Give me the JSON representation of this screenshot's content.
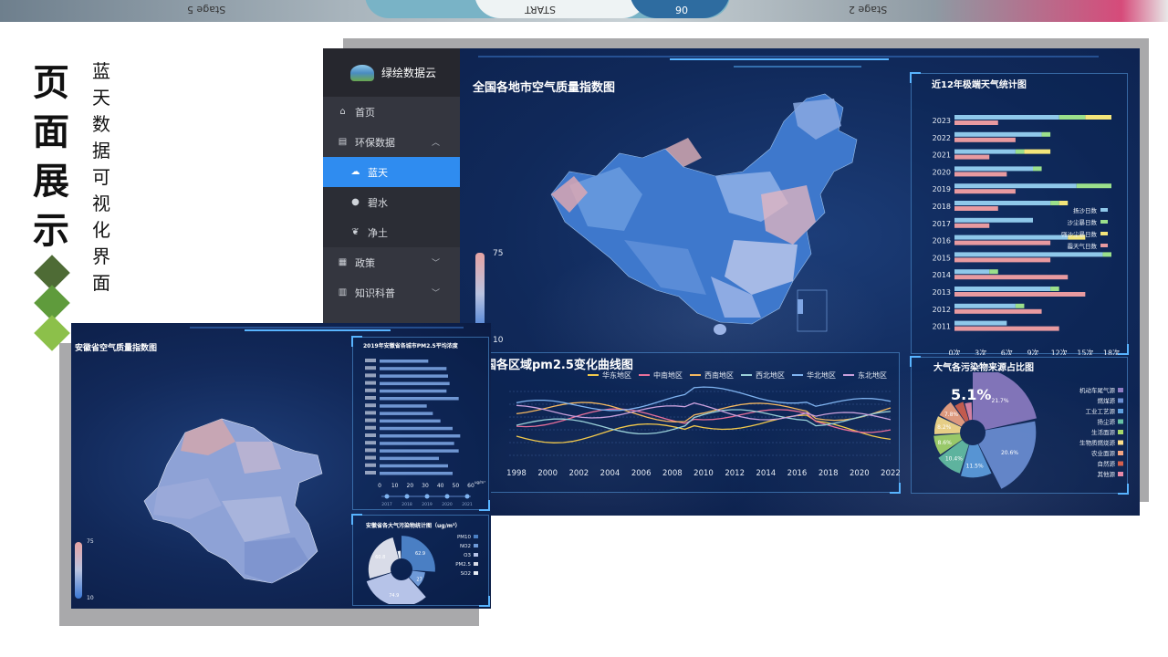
{
  "slide": {
    "title_chars": [
      "页",
      "面",
      "展",
      "示"
    ],
    "subtitle_chars": [
      "蓝",
      "天",
      "数",
      "据",
      "可",
      "视",
      "化",
      "界",
      "面"
    ],
    "diamond_colors": [
      "#4e6b35",
      "#5f9b3c",
      "#8cc04a"
    ]
  },
  "top_strip": {
    "text_left": "Stage 5",
    "text_mid": "START",
    "text_mid2": "06",
    "text_right": "Stage 2"
  },
  "main_dashboard": {
    "app_name": "绿绘数据云",
    "menu": [
      {
        "label": "首页",
        "icon": "home-icon"
      },
      {
        "label": "环保数据",
        "icon": "chart-icon",
        "expanded": true
      },
      {
        "label": "蓝天",
        "icon": "cloud-icon",
        "active": true
      },
      {
        "label": "碧水",
        "icon": "drop-icon"
      },
      {
        "label": "净土",
        "icon": "leaf-icon"
      },
      {
        "label": "政策",
        "icon": "book-icon"
      },
      {
        "label": "知识科普",
        "icon": "grid-icon"
      }
    ],
    "map_title": "全国各地市空气质量指数图",
    "map_legend_max": "75",
    "map_legend_min": "10",
    "weather_title": "近12年极端天气统计图",
    "weather_legend": [
      "扬沙日数",
      "沙尘暴日数",
      "强沙尘暴日数",
      "霾天气日数"
    ],
    "weather_legend_colors": [
      "#8fc8ea",
      "#9be08b",
      "#f3e57a",
      "#e89aa0"
    ],
    "weather_chart": {
      "type": "bar",
      "categories": [
        "2023",
        "2022",
        "2021",
        "2020",
        "2019",
        "2018",
        "2017",
        "2016",
        "2015",
        "2014",
        "2013",
        "2012",
        "2011"
      ],
      "series": [
        {
          "name": "扬沙日数",
          "values": [
            12,
            10,
            7,
            9,
            14,
            11,
            9,
            13,
            17,
            4,
            11,
            7,
            6
          ]
        },
        {
          "name": "沙尘暴日数",
          "values": [
            3,
            1,
            1,
            1,
            4,
            1,
            0,
            0,
            1,
            1,
            1,
            1,
            0
          ]
        },
        {
          "name": "强沙尘暴日数",
          "values": [
            3,
            0,
            3,
            0,
            0,
            1,
            0,
            2,
            0,
            0,
            0,
            0,
            0
          ]
        },
        {
          "name": "霾天气日数",
          "values": [
            5,
            7,
            4,
            6,
            7,
            5,
            4,
            11,
            11,
            13,
            15,
            10,
            12
          ]
        }
      ],
      "xticks": [
        "0次",
        "3次",
        "6次",
        "9次",
        "12次",
        "15次",
        "18次"
      ],
      "xlim": [
        0,
        18
      ]
    },
    "pm_title": "全国各区域pm2.5变化曲线图",
    "pm_chart": {
      "type": "line",
      "series_names": [
        "华东地区",
        "中南地区",
        "西南地区",
        "西北地区",
        "华北地区",
        "东北地区"
      ],
      "series_colors": [
        "#f2c94c",
        "#e86f9a",
        "#f4b860",
        "#9ad0d8",
        "#7fb3f0",
        "#c9a0dc"
      ],
      "x": [
        "1998",
        "2000",
        "2002",
        "2004",
        "2006",
        "2008",
        "2010",
        "2012",
        "2014",
        "2016",
        "2018",
        "2020",
        "2022"
      ],
      "y_unit": "μg/m³"
    },
    "pollution_title": "大气各污染物来源占比图",
    "pollution_center": "5.1%",
    "pollution_chart": {
      "type": "pie",
      "labels": [
        "机动车尾气源",
        "燃煤源",
        "工业工艺源",
        "扬尘源",
        "生活面源",
        "生物质燃烧源",
        "农业面源",
        "自然源",
        "其他源"
      ],
      "values": [
        21.7,
        20.6,
        11.5,
        10.4,
        8.6,
        8.2,
        7.8,
        5.1,
        4.1
      ],
      "colors": [
        "#8e7cc3",
        "#6b8fd4",
        "#5ea0e0",
        "#66c2a5",
        "#a6d96a",
        "#fee08b",
        "#f4a582",
        "#d6604d",
        "#e889a8"
      ],
      "value_labels": [
        "21.7%",
        "20.6%",
        "11.5%",
        "10.4%",
        "8.6%",
        "8.2%",
        "7.8%"
      ]
    }
  },
  "anhui_dashboard": {
    "map_title": "安徽省空气质量指数图",
    "legend_max": "75",
    "legend_min": "10",
    "pm_title": "2019年安徽省各城市PM2.5平均浓度",
    "pm_xticks": [
      "0",
      "10",
      "20",
      "30",
      "40",
      "50",
      "60"
    ],
    "pm_unit": "ug/m³",
    "pm_years": [
      "2017",
      "2018",
      "2019",
      "2020",
      "2021"
    ],
    "pollutant_title": "安徽省各大气污染物统计图（ug/m³）",
    "pollutant_chart": {
      "type": "pie",
      "labels": [
        "PM10",
        "NO2",
        "O3",
        "PM2.5",
        "SO2"
      ],
      "values": [
        62.9,
        27,
        74.9,
        60.8,
        8
      ],
      "value_labels": [
        "62.9",
        "27",
        "74.9",
        "60.8"
      ]
    }
  }
}
